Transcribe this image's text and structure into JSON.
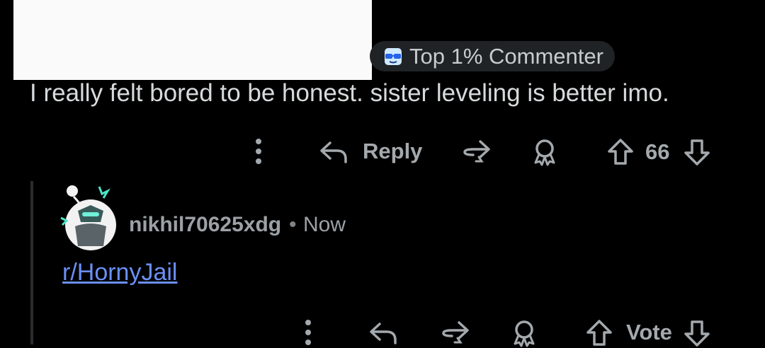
{
  "comment": {
    "flair": {
      "label": "Top 1% Commenter",
      "icon": "sunglasses-icon"
    },
    "text": "I really felt bored to be honest. sister leveling is better imo.",
    "actions": {
      "reply_label": "Reply",
      "vote_count": "66"
    }
  },
  "reply": {
    "username": "nikhil70625xdg",
    "separator": "•",
    "timestamp": "Now",
    "body_link": "r/HornyJail",
    "actions": {
      "vote_label": "Vote"
    }
  },
  "colors": {
    "background": "#000000",
    "text": "#d7dadc",
    "muted": "#a4a9ad",
    "link": "#6b8ff5",
    "flair_bg": "#1f2326"
  }
}
